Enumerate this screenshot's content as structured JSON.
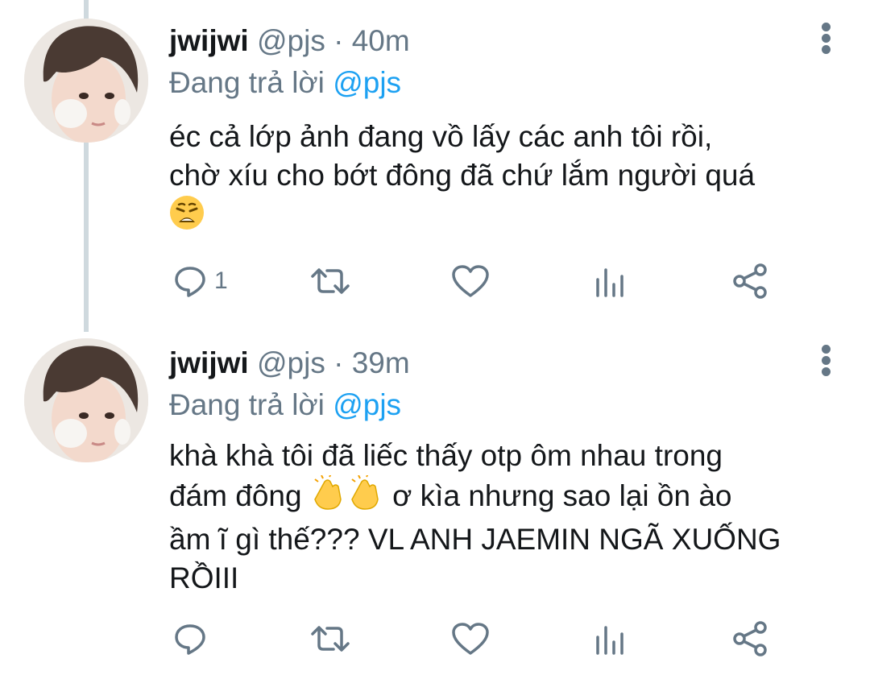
{
  "tweets": [
    {
      "display_name": "jwijwi",
      "handle": "@pjs",
      "separator": "·",
      "time": "40m",
      "replying_prefix": "Đang trả lời",
      "replying_to": "@pjs",
      "text_lines": [
        "éc cả lớp ảnh đang vồ lấy các anh tôi rồi,",
        "chờ xíu cho bớt đông đã chứ lắm người quá"
      ],
      "emoji": "weary-face",
      "reply_count": "1",
      "icons": [
        "reply-icon",
        "retweet-icon",
        "like-icon",
        "analytics-icon",
        "share-icon"
      ]
    },
    {
      "display_name": "jwijwi",
      "handle": "@pjs",
      "separator": "·",
      "time": "39m",
      "replying_prefix": "Đang trả lời",
      "replying_to": "@pjs",
      "text_lines": [
        "khà khà tôi đã liếc thấy otp ôm nhau trong",
        "đám đông",
        "ơ kìa nhưng sao lại ồn ào",
        "ầm ĩ gì thế??? VL ANH JAEMIN NGÃ XUỐNG",
        "RỒIII"
      ],
      "emoji": "clapping-hands",
      "reply_count": "",
      "icons": [
        "reply-icon",
        "retweet-icon",
        "like-icon",
        "analytics-icon",
        "share-icon"
      ]
    }
  ],
  "colors": {
    "text": "#14171a",
    "muted": "#657786",
    "link": "#1da1f2",
    "thread_line": "#cfd9de"
  }
}
